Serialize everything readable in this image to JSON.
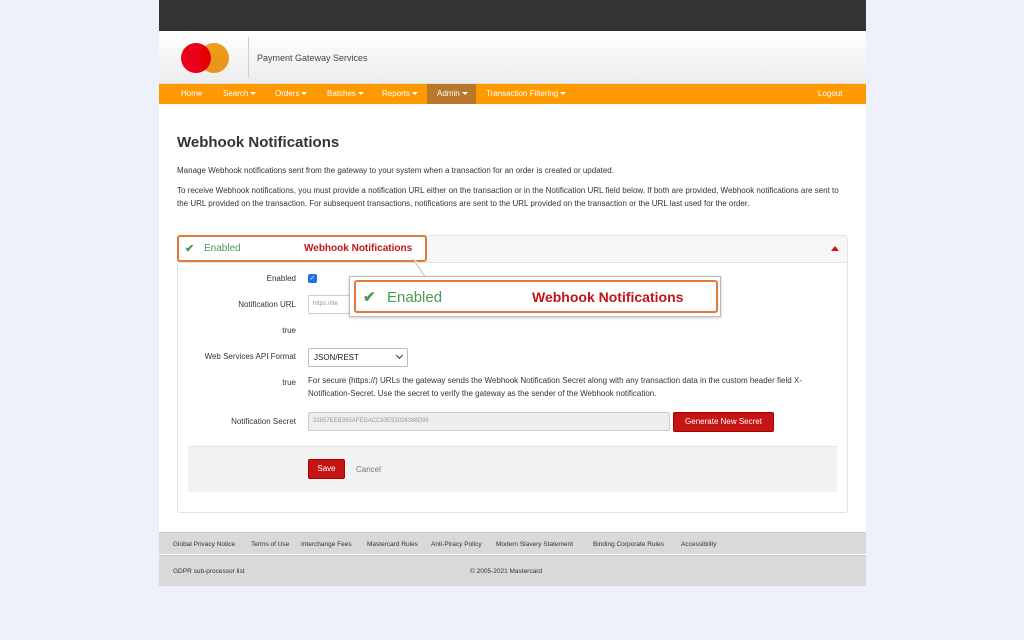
{
  "brand": {
    "title": "Payment Gateway Services",
    "colors": {
      "red": "#eb001b",
      "orange": "#f79e1b",
      "nav": "#ff9900"
    }
  },
  "nav": {
    "items": [
      {
        "label": "Home",
        "dropdown": false
      },
      {
        "label": "Search",
        "dropdown": true
      },
      {
        "label": "Orders",
        "dropdown": true
      },
      {
        "label": "Batches",
        "dropdown": true
      },
      {
        "label": "Reports",
        "dropdown": true
      },
      {
        "label": "Admin",
        "dropdown": true,
        "active": true
      },
      {
        "label": "Transaction Filtering",
        "dropdown": true
      }
    ],
    "logout": "Logout"
  },
  "page": {
    "title": "Webhook Notifications",
    "intro": "Manage Webhook notifications sent from the gateway to your system when a transaction for an order is created or updated.",
    "description": "To receive Webhook notifications, you must provide a notification URL either on the transaction or in the Notification URL field below. If both are provided, Webhook notifications are sent to the URL provided on the transaction. For subsequent transactions, notifications are sent to the URL provided on the transaction or the URL last used for the order."
  },
  "panel": {
    "status": "Enabled",
    "heading": "Webhook Notifications",
    "fields": {
      "enabled_label": "Enabled",
      "enabled_checked": true,
      "url_label": "Notification URL",
      "url_value": "https://de",
      "row_true_1": "true",
      "format_label": "Web Services API Format",
      "format_value": "JSON/REST",
      "row_true_2": "true",
      "help_text": "For secure (https://) URLs the gateway sends the Webhook Notification Secret along with any transaction data in the custom header field X-Notification-Secret. Use the secret to verify the gateway as the sender of the Webhook notification.",
      "secret_label": "Notification Secret",
      "secret_value": "22857EEB395AFEDACC83E93026388D99",
      "generate_label": "Generate New Secret"
    },
    "actions": {
      "save": "Save",
      "cancel": "Cancel"
    }
  },
  "zoom_callout": {
    "status": "Enabled",
    "heading": "Webhook Notifications"
  },
  "footer": {
    "links": [
      "Global Privacy Notice",
      "Terms of Use",
      "Interchange Fees",
      "Mastercard Rules",
      "Anti-Piracy Policy",
      "Modern Slavery Statement",
      "Binding Corporate Rules",
      "Accessibility"
    ],
    "subprocessor": "GDPR sub-processor list",
    "copyright": "© 2005-2021 Mastercard"
  }
}
